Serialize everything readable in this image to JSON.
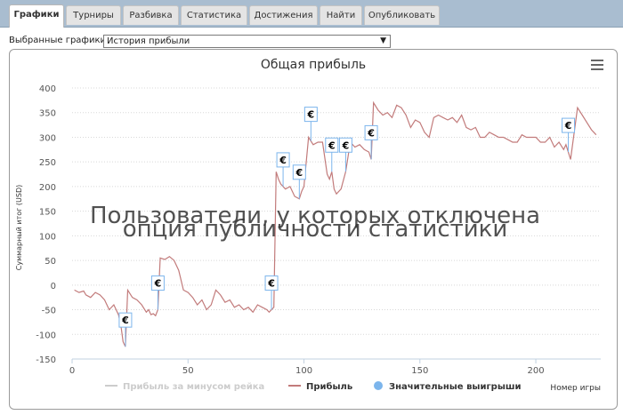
{
  "tabs": [
    {
      "label": "Графики",
      "active": true
    },
    {
      "label": "Турниры"
    },
    {
      "label": "Разбивка"
    },
    {
      "label": "Статистика"
    },
    {
      "label": "Достижения"
    },
    {
      "label": "Найти"
    },
    {
      "label": "Опубликовать"
    }
  ],
  "graph_select": {
    "label": "Выбранные графики:",
    "value": "История прибыли"
  },
  "menu_icon": "hamburger-menu-icon",
  "watermark": {
    "line1": "Пользователи, у которых отключена",
    "line2": "опция публичности статистики"
  },
  "colors": {
    "series": "#c27b7b",
    "legend_dot": "#7cb5ec",
    "legend_inactive": "#cccccc"
  },
  "chart_data": {
    "type": "line",
    "title": "Общая прибыль",
    "xlabel": "Номер игры",
    "ylabel": "Суммарный итог (USD)",
    "xlim": [
      0,
      228
    ],
    "ylim": [
      -150,
      400
    ],
    "x_ticks": [
      0,
      50,
      100,
      150,
      200
    ],
    "y_ticks": [
      -150,
      -100,
      -50,
      0,
      50,
      100,
      150,
      200,
      250,
      300,
      350,
      400
    ],
    "legend": [
      {
        "name": "Прибыль за минусом рейка",
        "inactive": true
      },
      {
        "name": "Прибыль"
      },
      {
        "name": "Значительные выигрыши",
        "marker": "circle"
      }
    ],
    "series": [
      {
        "name": "Прибыль",
        "x": [
          1,
          3,
          5,
          6,
          8,
          10,
          12,
          14,
          16,
          18,
          20,
          21,
          22,
          23,
          24,
          26,
          28,
          30,
          32,
          33,
          34,
          35,
          36,
          37,
          38,
          40,
          42,
          44,
          46,
          48,
          50,
          52,
          54,
          56,
          58,
          60,
          62,
          64,
          66,
          68,
          70,
          72,
          74,
          76,
          78,
          80,
          82,
          84,
          85,
          86,
          87,
          88,
          89,
          90,
          92,
          94,
          96,
          98,
          99,
          100,
          102,
          104,
          106,
          108,
          110,
          111,
          112,
          113,
          114,
          116,
          118,
          120,
          122,
          124,
          126,
          128,
          129,
          130,
          132,
          134,
          136,
          138,
          140,
          142,
          144,
          146,
          148,
          150,
          152,
          154,
          156,
          158,
          160,
          162,
          164,
          166,
          168,
          170,
          172,
          174,
          176,
          178,
          180,
          182,
          184,
          186,
          188,
          190,
          192,
          194,
          196,
          198,
          200,
          202,
          204,
          206,
          208,
          210,
          212,
          213,
          214,
          215,
          216,
          218,
          220,
          222,
          224,
          226
        ],
        "y": [
          -10,
          -15,
          -12,
          -20,
          -25,
          -15,
          -20,
          -30,
          -50,
          -40,
          -60,
          -80,
          -115,
          -125,
          -10,
          -25,
          -30,
          -40,
          -55,
          -50,
          -60,
          -58,
          -62,
          -50,
          55,
          52,
          58,
          50,
          30,
          -10,
          -15,
          -25,
          -40,
          -30,
          -50,
          -40,
          -10,
          -20,
          -35,
          -30,
          -45,
          -40,
          -50,
          -45,
          -55,
          -40,
          -45,
          -50,
          -55,
          -50,
          -45,
          230,
          215,
          205,
          195,
          200,
          180,
          175,
          190,
          200,
          300,
          285,
          290,
          290,
          225,
          215,
          230,
          195,
          185,
          195,
          230,
          290,
          280,
          285,
          275,
          270,
          255,
          370,
          355,
          345,
          350,
          340,
          365,
          360,
          345,
          320,
          335,
          330,
          310,
          300,
          340,
          345,
          340,
          335,
          340,
          330,
          345,
          320,
          315,
          320,
          300,
          300,
          310,
          305,
          300,
          300,
          295,
          290,
          290,
          305,
          300,
          300,
          300,
          290,
          290,
          300,
          280,
          290,
          275,
          285,
          270,
          255,
          290,
          360,
          345,
          330,
          315,
          305
        ]
      }
    ],
    "big_wins": [
      {
        "x": 23,
        "label": "€"
      },
      {
        "x": 37,
        "label": "€"
      },
      {
        "x": 86,
        "label": "€"
      },
      {
        "x": 91,
        "label": "€"
      },
      {
        "x": 98,
        "label": "€"
      },
      {
        "x": 103,
        "label": "€"
      },
      {
        "x": 112,
        "label": "€"
      },
      {
        "x": 118,
        "label": "€"
      },
      {
        "x": 129,
        "label": "€"
      },
      {
        "x": 214,
        "label": "€"
      }
    ]
  }
}
